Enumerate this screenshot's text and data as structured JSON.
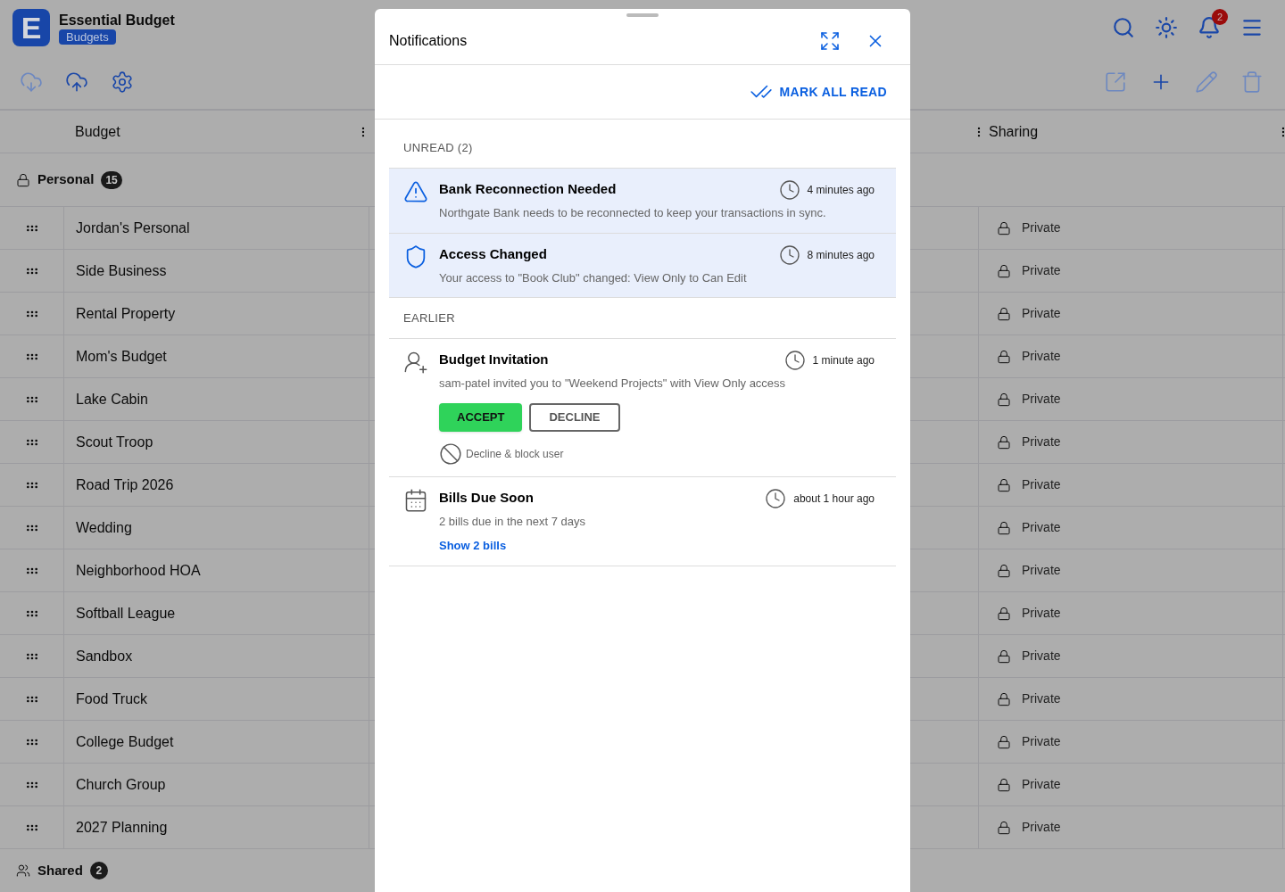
{
  "app": {
    "logo": "E",
    "name": "Essential Budget",
    "section": "Budgets",
    "notification_count": "2"
  },
  "table": {
    "columns": [
      {
        "label": "Budget"
      },
      {
        "label": "Sharing"
      }
    ]
  },
  "groups": [
    {
      "kind": "private",
      "name": "Personal",
      "count": "15",
      "rows": [
        {
          "name": "Jordan's Personal",
          "sharing": "Private"
        },
        {
          "name": "Side Business",
          "sharing": "Private"
        },
        {
          "name": "Rental Property",
          "sharing": "Private"
        },
        {
          "name": "Mom's Budget",
          "sharing": "Private"
        },
        {
          "name": "Lake Cabin",
          "sharing": "Private"
        },
        {
          "name": "Scout Troop",
          "sharing": "Private"
        },
        {
          "name": "Road Trip 2026",
          "sharing": "Private"
        },
        {
          "name": "Wedding",
          "sharing": "Private"
        },
        {
          "name": "Neighborhood HOA",
          "sharing": "Private"
        },
        {
          "name": "Softball League",
          "sharing": "Private"
        },
        {
          "name": "Sandbox",
          "sharing": "Private"
        },
        {
          "name": "Food Truck",
          "sharing": "Private"
        },
        {
          "name": "College Budget",
          "sharing": "Private"
        },
        {
          "name": "Church Group",
          "sharing": "Private"
        },
        {
          "name": "2027 Planning",
          "sharing": "Private"
        }
      ]
    },
    {
      "kind": "shared",
      "name": "Shared",
      "count": "2"
    }
  ],
  "notifications": {
    "title": "Notifications",
    "mark_all_read": "MARK ALL READ",
    "sections": [
      {
        "heading": "UNREAD (2)",
        "items": [
          {
            "kind": "warning",
            "unread": true,
            "title": "Bank Reconnection Needed",
            "time": "4 minutes ago",
            "message": "Northgate Bank needs to be reconnected to keep your transactions in sync."
          },
          {
            "kind": "access",
            "unread": true,
            "title": "Access Changed",
            "time": "8 minutes ago",
            "message": "Your access to \"Book Club\" changed: View Only to Can Edit"
          }
        ]
      },
      {
        "heading": "EARLIER",
        "items": [
          {
            "kind": "invitation",
            "unread": false,
            "title": "Budget Invitation",
            "time": "1 minute ago",
            "message": "sam-patel invited you to \"Weekend Projects\" with View Only access",
            "accept": "ACCEPT",
            "decline": "DECLINE",
            "block": "Decline & block user"
          },
          {
            "kind": "bills",
            "unread": false,
            "title": "Bills Due Soon",
            "time": "about 1 hour ago",
            "message": "2 bills due in the next 7 days",
            "link": "Show 2 bills"
          }
        ]
      }
    ]
  }
}
